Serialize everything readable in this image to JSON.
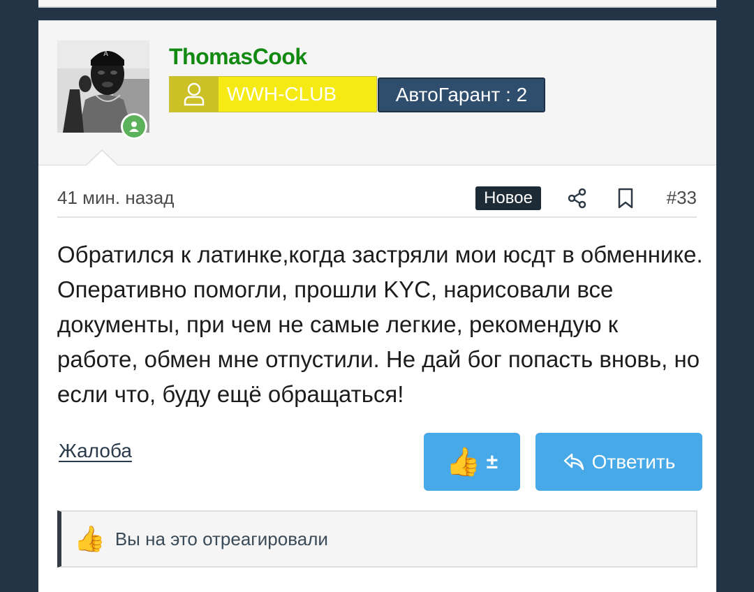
{
  "user": {
    "name": "ThomasCook",
    "club_badge": "WWH-CLUB",
    "garant_badge": "АвтоГарант : 2"
  },
  "post": {
    "time": "41 мин. назад",
    "new_badge": "Новое",
    "number": "#33",
    "body": "Обратился к латинке,когда застряли мои юсдт в обменнике. Оперативно помогли, прошли KYC, нарисовали все документы, при чем не самые легкие, рекомендую к работе, обмен мне отпустили. Не дай бог попасть вновь, но если что, буду ещё обращаться!"
  },
  "actions": {
    "report": "Жалоба",
    "like_emoji": "👍",
    "like_plus_minus": "±",
    "reply": "Ответить"
  },
  "reactions": {
    "emoji": "👍",
    "text": "Вы на это отреагировали"
  },
  "colors": {
    "background": "#243447",
    "username": "#128a12",
    "club_badge": "#f5ea14",
    "garant_badge": "#2f4d6c",
    "button": "#47a9e8"
  },
  "icons": {
    "club": "user-icon",
    "share": "share-icon",
    "bookmark": "bookmark-icon",
    "reply": "reply-arrow-icon",
    "online": "online-status-icon"
  }
}
